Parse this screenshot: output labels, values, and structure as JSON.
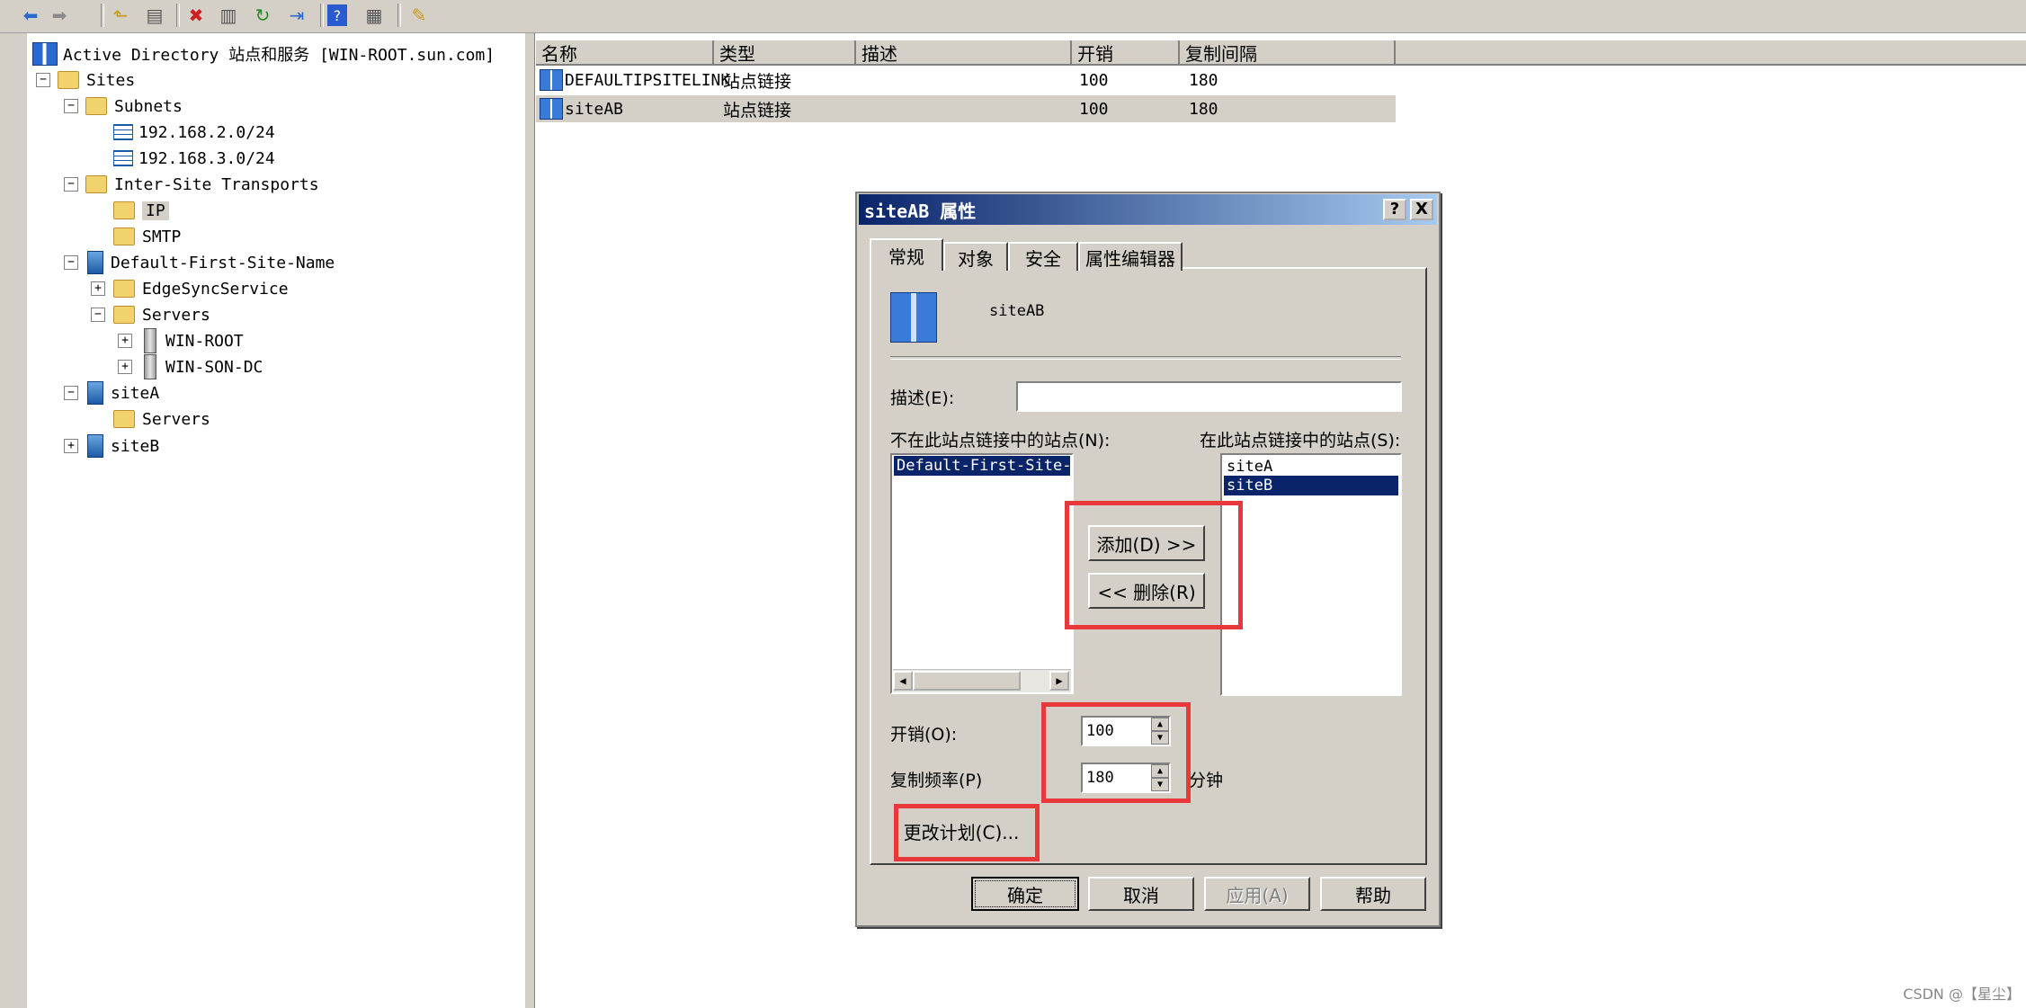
{
  "toolbar": {
    "icons": [
      "back-icon",
      "forward-icon",
      "up-icon",
      "show-hide-tree-icon",
      "delete-icon",
      "properties-icon",
      "refresh-icon",
      "export-icon",
      "help-icon",
      "view-icon",
      "new-icon"
    ]
  },
  "tree": {
    "root": "Active Directory 站点和服务 [WIN-ROOT.sun.com]",
    "sites": "Sites",
    "subnets": "Subnets",
    "subnet1": "192.168.2.0/24",
    "subnet2": "192.168.3.0/24",
    "inter_site": "Inter-Site Transports",
    "ip": "IP",
    "smtp": "SMTP",
    "default_site": "Default-First-Site-Name",
    "edgesync": "EdgeSyncService",
    "servers": "Servers",
    "win_root": "WIN-ROOT",
    "win_son": "WIN-SON-DC",
    "site_a": "siteA",
    "site_a_servers": "Servers",
    "site_b": "siteB"
  },
  "list": {
    "columns": [
      "名称",
      "类型",
      "描述",
      "开销",
      "复制间隔"
    ],
    "rows": [
      {
        "name": "DEFAULTIPSITELINK",
        "type": "站点链接",
        "desc": "",
        "cost": "100",
        "interval": "180"
      },
      {
        "name": "siteAB",
        "type": "站点链接",
        "desc": "",
        "cost": "100",
        "interval": "180"
      }
    ]
  },
  "dialog": {
    "title": "siteAB 属性",
    "help_btn": "?",
    "close_btn": "X",
    "tabs": [
      "常规",
      "对象",
      "安全",
      "属性编辑器"
    ],
    "object_name": "siteAB",
    "desc_label": "描述(E):",
    "desc_value": "",
    "not_in_label": "不在此站点链接中的站点(N):",
    "in_label": "在此站点链接中的站点(S):",
    "not_in_items": [
      "Default-First-Site-Na"
    ],
    "in_items": [
      "siteA",
      "siteB"
    ],
    "add_btn": "添加(D) >>",
    "remove_btn": "<< 删除(R)",
    "cost_label": "开销(O):",
    "cost_value": "100",
    "freq_label": "复制频率(P)",
    "freq_value": "180",
    "freq_unit": "分钟",
    "schedule_btn": "更改计划(C)...",
    "ok_btn": "确定",
    "cancel_btn": "取消",
    "apply_btn": "应用(A)",
    "help2_btn": "帮助"
  },
  "watermark": "CSDN @【星尘】",
  "colors": {
    "highlight_box": "#e8383b",
    "title_bar": "#0a246a",
    "selection": "#0a246a"
  }
}
